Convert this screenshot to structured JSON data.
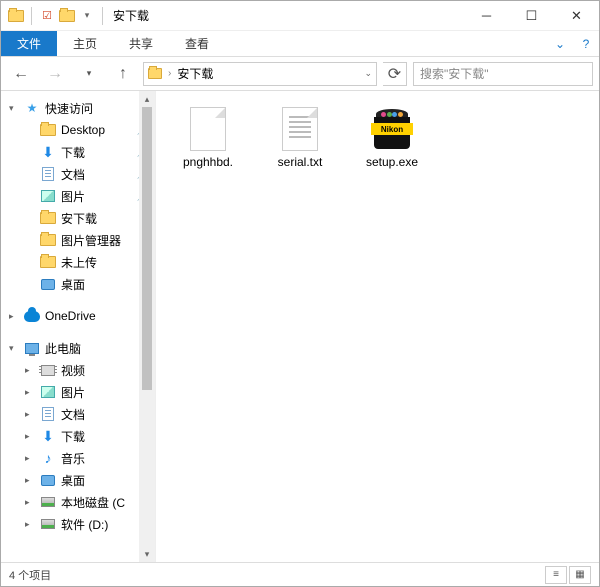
{
  "title": "安下载",
  "ribbon": {
    "file": "文件",
    "home": "主页",
    "share": "共享",
    "view": "查看"
  },
  "breadcrumb": {
    "current": "安下载"
  },
  "search": {
    "placeholder": "搜索\"安下载\""
  },
  "sidebar": {
    "quick": "快速访问",
    "quick_items": [
      {
        "label": "Desktop",
        "icon": "folder",
        "pinned": true
      },
      {
        "label": "下载",
        "icon": "down",
        "pinned": true
      },
      {
        "label": "文档",
        "icon": "doc",
        "pinned": true
      },
      {
        "label": "图片",
        "icon": "pic",
        "pinned": true
      },
      {
        "label": "安下载",
        "icon": "folder"
      },
      {
        "label": "图片管理器",
        "icon": "folder"
      },
      {
        "label": "未上传",
        "icon": "folder"
      },
      {
        "label": "桌面",
        "icon": "desktop"
      }
    ],
    "onedrive": "OneDrive",
    "thispc": "此电脑",
    "pc_items": [
      {
        "label": "视频",
        "icon": "video"
      },
      {
        "label": "图片",
        "icon": "pic"
      },
      {
        "label": "文档",
        "icon": "doc"
      },
      {
        "label": "下载",
        "icon": "down"
      },
      {
        "label": "音乐",
        "icon": "music"
      },
      {
        "label": "桌面",
        "icon": "desktop"
      },
      {
        "label": "本地磁盘 (C",
        "icon": "disk"
      },
      {
        "label": "软件 (D:)",
        "icon": "disk"
      }
    ]
  },
  "files": [
    {
      "name": "pnghhbd.",
      "type": "blank"
    },
    {
      "name": "serial.txt",
      "type": "txt"
    },
    {
      "name": "setup.exe",
      "type": "setup",
      "brand": "Nikon"
    }
  ],
  "status": {
    "count": "4 个项目"
  },
  "icon_colors": [
    "#e24b8b",
    "#5bb04d",
    "#4aa0e8",
    "#f2a73a"
  ]
}
